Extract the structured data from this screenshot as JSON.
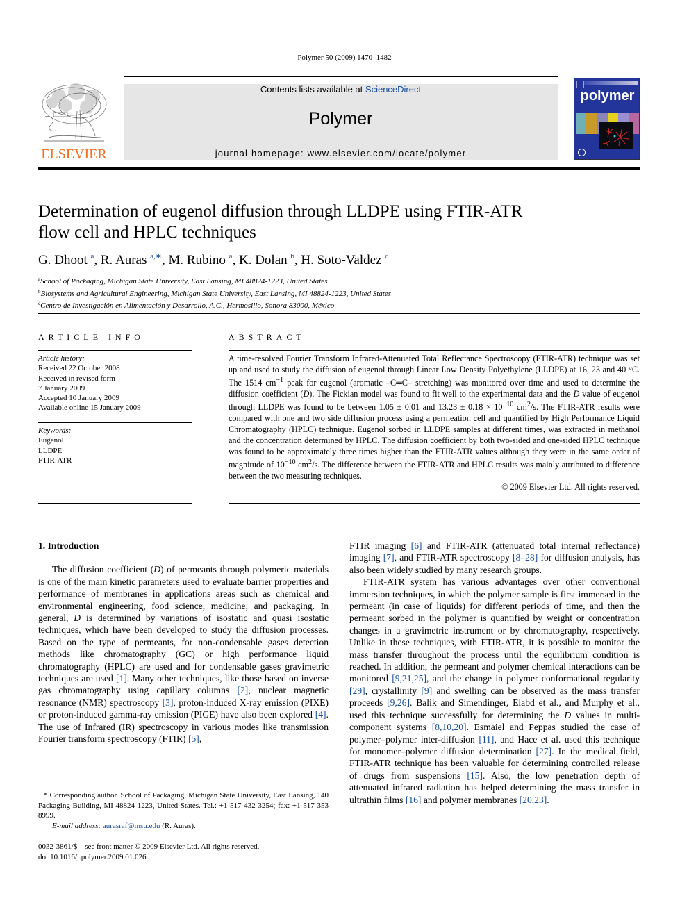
{
  "running_head": "Polymer 50 (2009) 1470–1482",
  "publisher": {
    "logo_icon": "elsevier-tree-icon",
    "name": "ELSEVIER",
    "brand_color": "#f26d1f"
  },
  "banner": {
    "contents_prefix": "Contents lists available at ",
    "sciencedirect_link": "ScienceDirect",
    "journal_title": "Polymer",
    "homepage": "journal homepage: www.elsevier.com/locate/polymer",
    "background_color": "#e6e6e6",
    "link_color": "#1a4c9c"
  },
  "cover": {
    "title": "polymer",
    "background_color": "#23349a"
  },
  "article": {
    "title_line1": "Determination of eugenol diffusion through LLDPE using FTIR-ATR",
    "title_line2": "flow cell and HPLC techniques",
    "authors": [
      {
        "name": "G. Dhoot",
        "sup": "a"
      },
      {
        "name": "R. Auras",
        "sup": "a,∗"
      },
      {
        "name": "M. Rubino",
        "sup": "a"
      },
      {
        "name": "K. Dolan",
        "sup": "b"
      },
      {
        "name": "H. Soto-Valdez",
        "sup": "c"
      }
    ],
    "affiliations": [
      {
        "key": "a",
        "text": "School of Packaging, Michigan State University, East Lansing, MI 48824-1223, United States"
      },
      {
        "key": "b",
        "text": "Biosystems and Agricultural Engineering, Michigan State University, East Lansing, MI 48824-1223, United States"
      },
      {
        "key": "c",
        "text": "Centro de Investigación en Alimentación y Desarrollo, A.C., Hermosillo, Sonora 83000, México"
      }
    ]
  },
  "article_info": {
    "heading": "ARTICLE INFO",
    "history_label": "Article history:",
    "history": [
      "Received 22 October 2008",
      "Received in revised form",
      "7 January 2009",
      "Accepted 10 January 2009",
      "Available online 15 January 2009"
    ],
    "keywords_label": "Keywords:",
    "keywords": [
      "Eugenol",
      "LLDPE",
      "FTIR-ATR"
    ]
  },
  "abstract": {
    "heading": "ABSTRACT",
    "p1": "A time-resolved Fourier Transform Infrared-Attenuated Total Reflectance Spectroscopy (FTIR-ATR) technique was set up and used to study the diffusion of eugenol through Linear Low Density Polyethylene (LLDPE) at 16, 23 and 40 °C. The 1514 cm",
    "p1_sup1": "−1",
    "p2": " peak for eugenol (aromatic –C═C– stretching) was monitored over time and used to determine the diffusion coefficient (",
    "p2_D": "D",
    "p3": "). The Fickian model was found to fit well to the experimental data and the ",
    "p3_D": "D",
    "p4": " value of eugenol through LLDPE was found to be between 1.05 ± 0.01 and 13.23 ± 0.18 × 10",
    "p4_sup": "−10",
    "p5": " cm",
    "p5_sup": "2",
    "p6": "/s. The FTIR-ATR results were compared with one and two side diffusion process using a permeation cell and quantified by High Performance Liquid Chromatography (HPLC) technique. Eugenol sorbed in LLDPE samples at different times, was extracted in methanol and the concentration determined by HPLC. The diffusion coefficient by both two-sided and one-sided HPLC technique was found to be approximately three times higher than the FTIR-ATR values although they were in the same order of magnitude of 10",
    "p6_sup": "−10",
    "p7": " cm",
    "p7_sup": "2",
    "p8": "/s. The difference between the FTIR-ATR and HPLC results was mainly attributed to difference between the two measuring techniques.",
    "copyright": "© 2009 Elsevier Ltd. All rights reserved."
  },
  "introduction": {
    "heading": "1.  Introduction",
    "left_col": {
      "t1": "The diffusion coefficient (",
      "D1": "D",
      "t2": ") of permeants through polymeric materials is one of the main kinetic parameters used to evaluate barrier properties and performance of membranes in applications areas such as chemical and environmental engineering, food science, medicine, and packaging. In general, ",
      "D2": "D",
      "t3": " is determined by variations of isostatic and quasi isostatic techniques, which have been developed to study the diffusion processes. Based on the type of permeants, for non-condensable gases detection methods like chromatography (GC) or high performance liquid chromatography (HPLC) are used and for condensable gases gravimetric techniques are used ",
      "r1": "[1]",
      "t4": ". Many other techniques, like those based on inverse gas chromatography using capillary columns ",
      "r2": "[2]",
      "t5": ", nuclear magnetic resonance (NMR) spectroscopy ",
      "r3": "[3]",
      "t6": ", proton-induced X-ray emission (PIXE) or proton-induced gamma-ray emission (PIGE) have also been explored ",
      "r4": "[4]",
      "t7": ". The use of Infrared (IR) spectroscopy in various modes like transmission Fourier transform spectroscopy (FTIR) ",
      "r5": "[5]",
      "t8": ","
    },
    "right_col": {
      "a1": "FTIR imaging ",
      "r6": "[6]",
      "a2": " and FTIR-ATR (attenuated total internal reflectance) imaging ",
      "r7": "[7]",
      "a3": ", and FTIR-ATR spectroscopy ",
      "r8": "[8–28]",
      "a4": " for diffusion analysis, has also been widely studied by many research groups.",
      "b1": "FTIR-ATR system has various advantages over other conventional immersion techniques, in which the polymer sample is first immersed in the permeant (in case of liquids) for different periods of time, and then the permeant sorbed in the polymer is quantified by weight or concentration changes in a gravimetric instrument or by chromatography, respectively. Unlike in these techniques, with FTIR-ATR, it is possible to monitor the mass transfer throughout the process until the equilibrium condition is reached. In addition, the permeant and polymer chemical interactions can be monitored ",
      "r9": "[9,21,25]",
      "b2": ", and the change in polymer conformational regularity ",
      "r10": "[29]",
      "b3": ", crystallinity ",
      "r11": "[9]",
      "b4": " and swelling can be observed as the mass transfer proceeds ",
      "r12": "[9,26]",
      "b5": ". Balik and Simendinger, Elabd et al., and Murphy et al., used this technique successfully for determining the ",
      "bD": "D",
      "b6": " values in multi-component systems ",
      "r13": "[8,10,20]",
      "b7": ". Esmaiel and Peppas studied the case of polymer–polymer inter-diffusion ",
      "r14": "[11]",
      "b8": ", and Hace et al. used this technique for monomer–polymer diffusion determination ",
      "r15": "[27]",
      "b9": ". In the medical field, FTIR-ATR technique has been valuable for determining controlled release of drugs from suspensions ",
      "r16": "[15]",
      "b10": ". Also, the low penetration depth of attenuated infrared radiation has helped determining the mass transfer in ultrathin films ",
      "r17": "[16]",
      "b11": " and polymer membranes ",
      "r18": "[20,23]",
      "b12": "."
    }
  },
  "footnote": {
    "corresponding": "* Corresponding author. School of Packaging, Michigan State University, East Lansing, 140 Packaging Building, MI 48824-1223, United States. Tel.: +1 517 432 3254; fax: +1 517 353 8999.",
    "email_label": "E-mail address:",
    "email": "aurasraf@msu.edu",
    "email_suffix": " (R. Auras).",
    "front_matter": "0032-3861/$ – see front matter © 2009 Elsevier Ltd. All rights reserved.",
    "doi": "doi:10.1016/j.polymer.2009.01.026"
  }
}
